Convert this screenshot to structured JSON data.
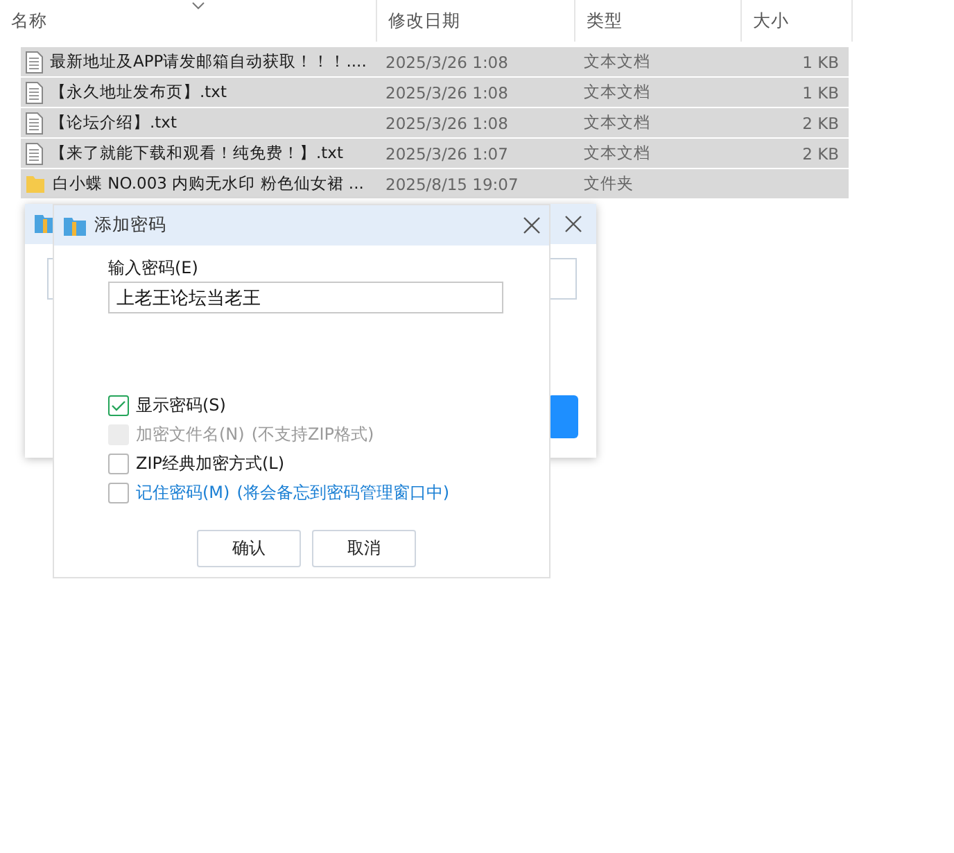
{
  "columns": [
    "名称",
    "修改日期",
    "类型",
    "大小"
  ],
  "files": [
    {
      "kind": "text",
      "name": "最新地址及APP请发邮箱自动获取！！！....",
      "date": "2025/3/26 1:08",
      "type": "文本文档",
      "size": "1 KB",
      "selected": true
    },
    {
      "kind": "text",
      "name": "【永久地址发布页】.txt",
      "date": "2025/3/26 1:08",
      "type": "文本文档",
      "size": "1 KB",
      "selected": true
    },
    {
      "kind": "text",
      "name": "【论坛介绍】.txt",
      "date": "2025/3/26 1:08",
      "type": "文本文档",
      "size": "2 KB",
      "selected": true
    },
    {
      "kind": "text",
      "name": "【来了就能下载和观看！纯免费！】.txt",
      "date": "2025/3/26 1:07",
      "type": "文本文档",
      "size": "2 KB",
      "selected": true
    },
    {
      "kind": "folder",
      "name": "白小蝶 NO.003 内购无水印 粉色仙女裙 ...",
      "date": "2025/8/15 19:07",
      "type": "文件夹",
      "selected": true
    }
  ],
  "dialog": {
    "title": "添加密码",
    "password_label": "输入密码(E)",
    "password_value": "上老王论坛当老王",
    "options": [
      {
        "kind": "plain",
        "label": "显示密码(S)",
        "checked": true,
        "disabled": false
      },
      {
        "kind": "plain",
        "label": "加密文件名(N)",
        "note": "(不支持ZIP格式)",
        "checked": false,
        "disabled": true
      },
      {
        "kind": "plain",
        "label": "ZIP经典加密方式(L)",
        "checked": false,
        "disabled": false
      },
      {
        "kind": "link",
        "label": "记住密码(M)",
        "note": "(将会备忘到密码管理窗口中)",
        "checked": false,
        "disabled": false
      }
    ],
    "buttons": [
      "确认",
      "取消"
    ]
  }
}
